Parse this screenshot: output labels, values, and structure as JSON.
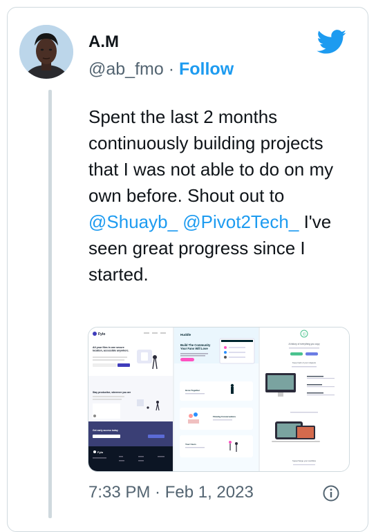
{
  "author": {
    "name": "A.M",
    "handle": "@ab_fmo",
    "separator": "·",
    "follow_label": "Follow"
  },
  "tweet": {
    "text_part1": "Spent the last 2 months continuously building projects that I was not able to do on my own before. Shout out to",
    "mention1": "@Shuayb_",
    "mention2": "@Pivot2Tech_",
    "text_part2": "I've seen great progress since I started."
  },
  "media": {
    "panels": [
      {
        "logo": "Fylo",
        "headline": "All your files in one secure location, accessible anywhere.",
        "subhead": "Stay productive, wherever you are",
        "cta": "Get early access today"
      },
      {
        "logo": "Huddle",
        "headline": "Build The Community Your Fans Will Love",
        "features": [
          "Grow Together",
          "Flowing Conversations",
          "Your Users"
        ]
      },
      {
        "headline": "A history of everything you copy",
        "subhead": "Keep track of your snippets",
        "bottom": "Supercharge your workflow"
      }
    ]
  },
  "footer": {
    "timestamp": "7:33 PM · Feb 1, 2023"
  },
  "colors": {
    "accent": "#1d9bf0",
    "text": "#0f1419",
    "secondary": "#536471",
    "border": "#cfd9de"
  },
  "icons": {
    "brand": "twitter-bird-icon",
    "info": "info-icon"
  }
}
